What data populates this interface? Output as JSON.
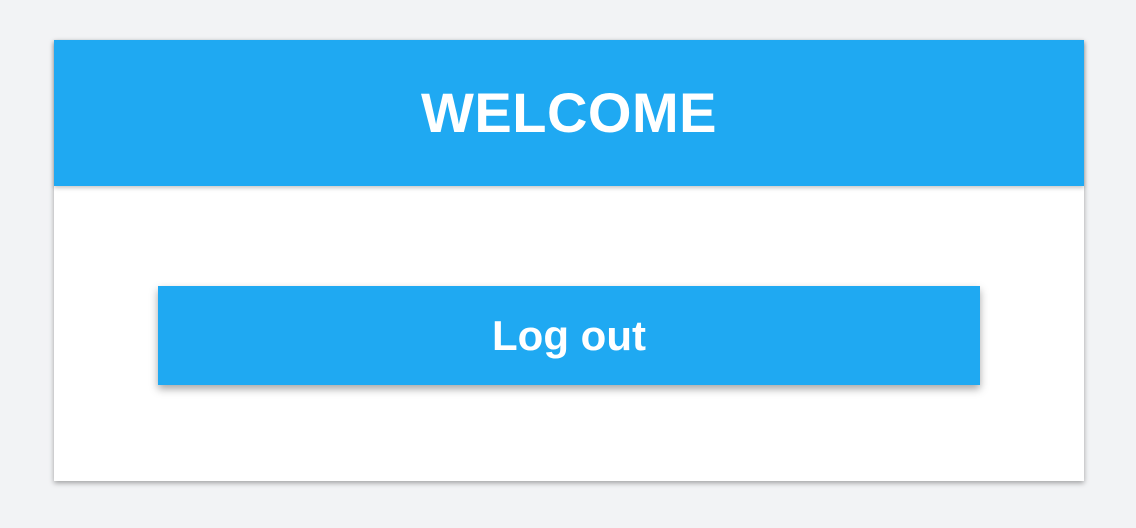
{
  "colors": {
    "accent": "#1fa9f2",
    "page_background": "#f2f3f5",
    "card_background": "#ffffff",
    "text_on_accent": "#ffffff"
  },
  "header": {
    "title": "WELCOME"
  },
  "actions": {
    "logout_label": "Log out"
  }
}
